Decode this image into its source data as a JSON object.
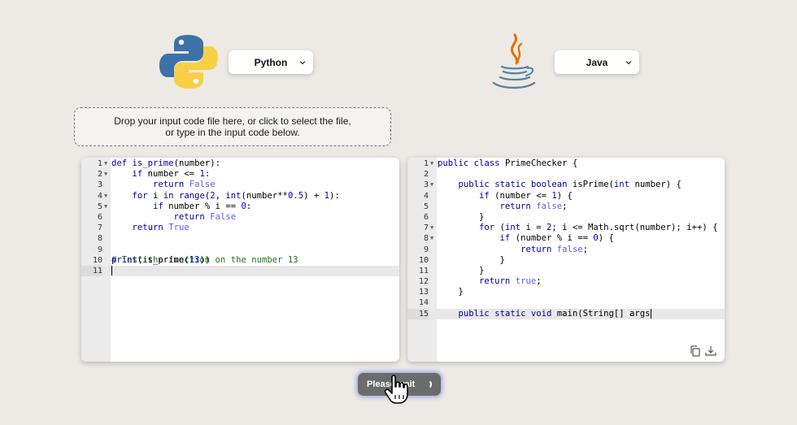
{
  "source": {
    "language_icon": "python-logo-icon",
    "language": "Python"
  },
  "target": {
    "language_icon": "java-logo-icon",
    "language": "Java"
  },
  "dropzone": {
    "line1": "Drop your input code file here, or click to select the file,",
    "line2": "or type in the input code below."
  },
  "input_editor": {
    "line_numbers": [
      "1",
      "2",
      "3",
      "4",
      "5",
      "6",
      "7",
      "8",
      "9",
      "10",
      "11"
    ],
    "lines": [
      "def is_prime(number):",
      "    if number <= 1:",
      "        return False",
      "    for i in range(2, int(number**0.5) + 1):",
      "        if number % i == 0:",
      "            return False",
      "    return True",
      "",
      "# Test the function on the number 13",
      "print(is_prime(13))",
      ""
    ]
  },
  "output_editor": {
    "line_numbers": [
      "1",
      "2",
      "3",
      "4",
      "5",
      "6",
      "7",
      "8",
      "9",
      "10",
      "11",
      "12",
      "13",
      "14",
      "15"
    ],
    "lines": [
      "public class PrimeChecker {",
      "",
      "    public static boolean isPrime(int number) {",
      "        if (number <= 1) {",
      "            return false;",
      "        }",
      "        for (int i = 2; i <= Math.sqrt(number); i++) {",
      "            if (number % i == 0) {",
      "                return false;",
      "            }",
      "        }",
      "        return true;",
      "    }",
      "",
      "    public static void main(String[] args"
    ],
    "copy_icon": "copy-icon",
    "download_icon": "download-icon"
  },
  "action_button": {
    "label": "Please wait",
    "icon": "spinner-icon"
  },
  "cursor_icon": "hand-pointer-icon",
  "colors": {
    "background": "#ede9e4",
    "python_blue": "#3d72a8",
    "python_yellow": "#f7d046",
    "java_orange": "#e76f00",
    "java_blue": "#5382a1"
  }
}
